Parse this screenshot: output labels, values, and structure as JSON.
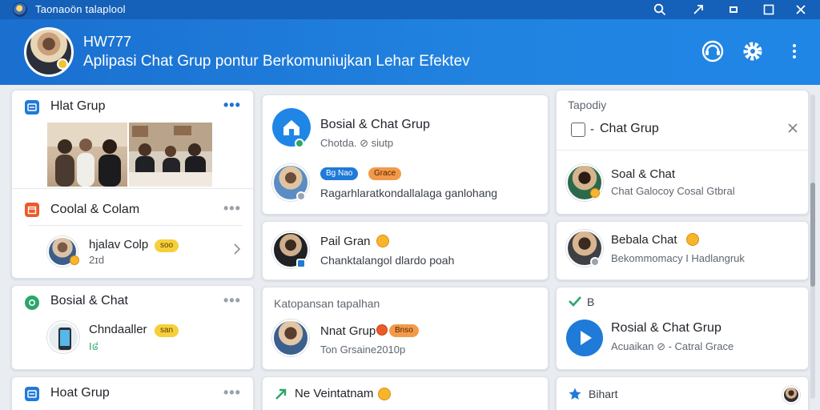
{
  "window": {
    "title": "Taonaoön talaplool",
    "app_icon": "app-logo-icon",
    "controls": [
      "search-icon",
      "pin-icon",
      "minimize-icon",
      "maximize-icon",
      "close-icon"
    ]
  },
  "header": {
    "name": "HW777",
    "subtitle": "Aplipasi Chat Grup pontur Berkomuniujkan Lehar Efektev",
    "icons": [
      "support-icon",
      "settings-gear-icon",
      "more-vertical-icon"
    ]
  },
  "colors": {
    "titlebar": "#1560b8",
    "header": "#2183e0",
    "accent_blue": "#1f7ad8",
    "badge_yellow": "#f7cf3a",
    "badge_orange": "#f29a4a",
    "background": "#e9edf2"
  },
  "column1": {
    "card1": {
      "title": "Hlat Grup",
      "icon": "chat-group-icon",
      "photos": [
        "group-photo-1",
        "group-photo-2"
      ]
    },
    "card2": {
      "title": "Coolal & Colam",
      "icon": "calendar-icon",
      "item": {
        "name": "hjalav Colp",
        "badge": "soo",
        "sub": "2ɪd"
      }
    },
    "card3": {
      "title": "Bosial & Chat",
      "icon": "chat-bubble-icon",
      "item": {
        "name": "Chndaaller",
        "badge": "san",
        "sub": "ꓲ៨"
      }
    },
    "card4": {
      "title": "Hoat Grup",
      "icon": "chat-group-icon"
    }
  },
  "column2": {
    "card1": {
      "title": "Bosial & Chat Grup",
      "sub": "Chotda. ⊘ siutp",
      "pills": [
        "Bg Nao",
        "Grace"
      ],
      "message": "Ragarhlaratkondallalaga ganlohang"
    },
    "card2": {
      "name": "Pail Gran",
      "message": "Chanktalangol dlardo poah"
    },
    "card3": {
      "section_title": "Katopansan tapalhan",
      "name": "Nnat Grup",
      "pill": "Bnso",
      "sub": "Ton Grsaine2010p"
    },
    "card4": {
      "name": "Ne Veintatnam"
    }
  },
  "column3": {
    "card1": {
      "breadcrumb": "Tapodiy",
      "title": "Chat Grup",
      "title_prefix": "-",
      "item": {
        "name": "Soal & Chat",
        "sub": "Chat Galocoy Cosal Gtbral"
      }
    },
    "card2": {
      "name": "Bebala Chat",
      "sub": "Bekommomacy I Hadlangruk"
    },
    "card3": {
      "label": "B",
      "title": "Rosial & Chat Grup",
      "sub": "Acuaikan ⊘ - Catral Grace"
    },
    "card4": {
      "label": "Bihart"
    }
  }
}
